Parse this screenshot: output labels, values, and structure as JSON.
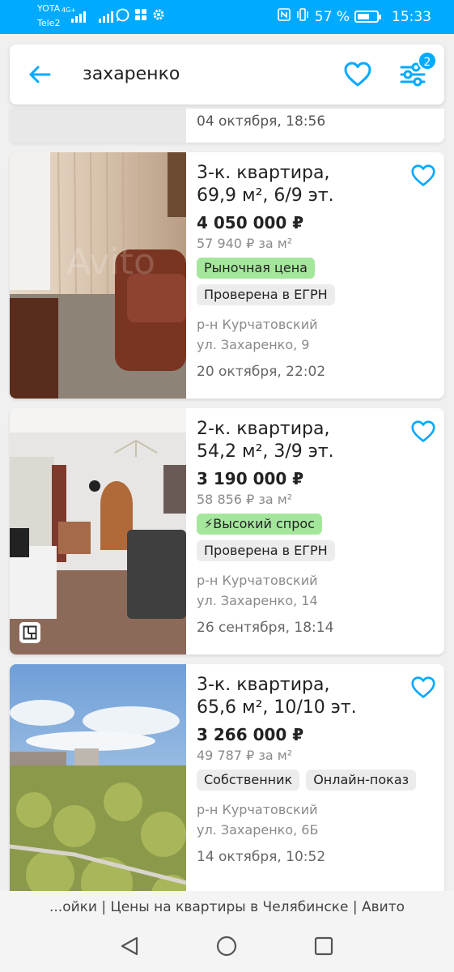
{
  "status_bar": {
    "carrier_1": "YOTA",
    "carrier_2": "Tele2",
    "network_type": "4G+",
    "battery_percent": "57 %",
    "time": "15:33",
    "icons": [
      "signal-icon",
      "whatsapp-icon",
      "apps-icon",
      "settings-icon",
      "nfc-icon",
      "vibrate-icon",
      "battery-icon"
    ]
  },
  "header": {
    "query": "захаренко",
    "filter_count": "2",
    "icons": [
      "back-arrow-icon",
      "heart-icon",
      "filter-icon"
    ]
  },
  "previous_listing": {
    "date": "04 октября, 18:56"
  },
  "listings": [
    {
      "title_line1": "3-к. квартира,",
      "title_line2": "69,9 м², 6/9 эт.",
      "price": "4 050 000 ₽",
      "price_per_m2": "57 940 ₽ за м²",
      "badge_market": "Рыночная цена",
      "badge_verified": "Проверена в ЕГРН",
      "district": "р-н Курчатовский",
      "street": "ул. Захаренко, 9",
      "date": "20 октября, 22:02"
    },
    {
      "title_line1": "2-к. квартира,",
      "title_line2": "54,2 м², 3/9 эт.",
      "price": "3 190 000 ₽",
      "price_per_m2": "58 856 ₽ за м²",
      "badge_demand": "Высокий спрос",
      "badge_verified": "Проверена в ЕГРН",
      "district": "р-н Курчатовский",
      "street": "ул. Захаренко, 14",
      "date": "26 сентября, 18:14"
    },
    {
      "title_line1": "3-к. квартира,",
      "title_line2": "65,6 м², 10/10 эт.",
      "price": "3 266 000 ₽",
      "price_per_m2": "49 787 ₽ за м²",
      "badge_owner": "Собственник",
      "badge_online": "Онлайн-показ",
      "district": "р-н Курчатовский",
      "street": "ул. Захаренко, 6Б",
      "date": "14 октября, 10:52"
    }
  ],
  "page_title": "...ойки | Цены на квартиры в Челябинске | Авито",
  "colors": {
    "accent": "#00aaff",
    "badge_green": "#a4e79c",
    "badge_grey": "#ececec"
  }
}
